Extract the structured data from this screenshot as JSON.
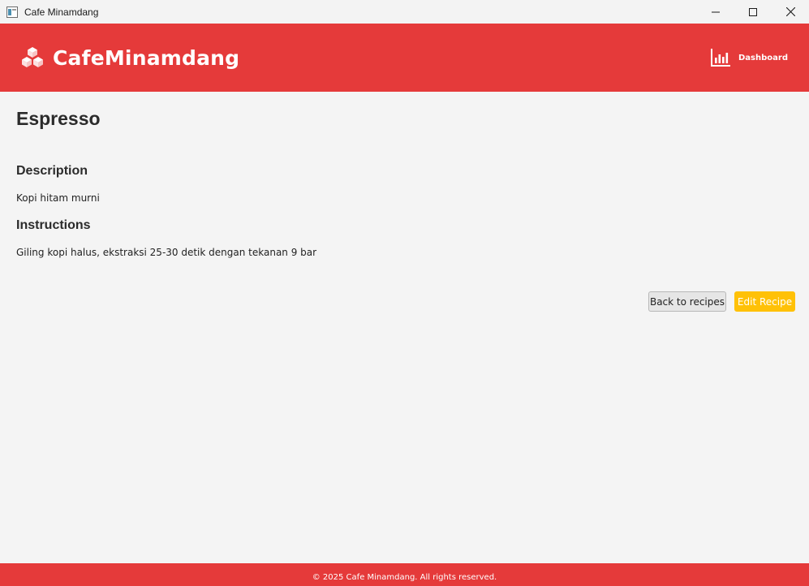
{
  "window": {
    "title": "Cafe Minamdang"
  },
  "header": {
    "brand_name": "CafeMinamdang",
    "brand_icon": "cubes-icon",
    "nav_dashboard_label": "Dashboard",
    "nav_dashboard_icon": "bar-chart-icon",
    "color": "#e53a3a"
  },
  "recipe": {
    "title": "Espresso",
    "description_heading": "Description",
    "description": "Kopi hitam murni",
    "instructions_heading": "Instructions",
    "instructions": "Giling kopi halus, ekstraksi 25-30 detik dengan tekanan 9 bar"
  },
  "actions": {
    "back_label": "Back to recipes",
    "edit_label": "Edit Recipe",
    "edit_color": "#ffc107"
  },
  "footer": {
    "copyright": "© 2025 Cafe Minamdang. All rights reserved."
  }
}
